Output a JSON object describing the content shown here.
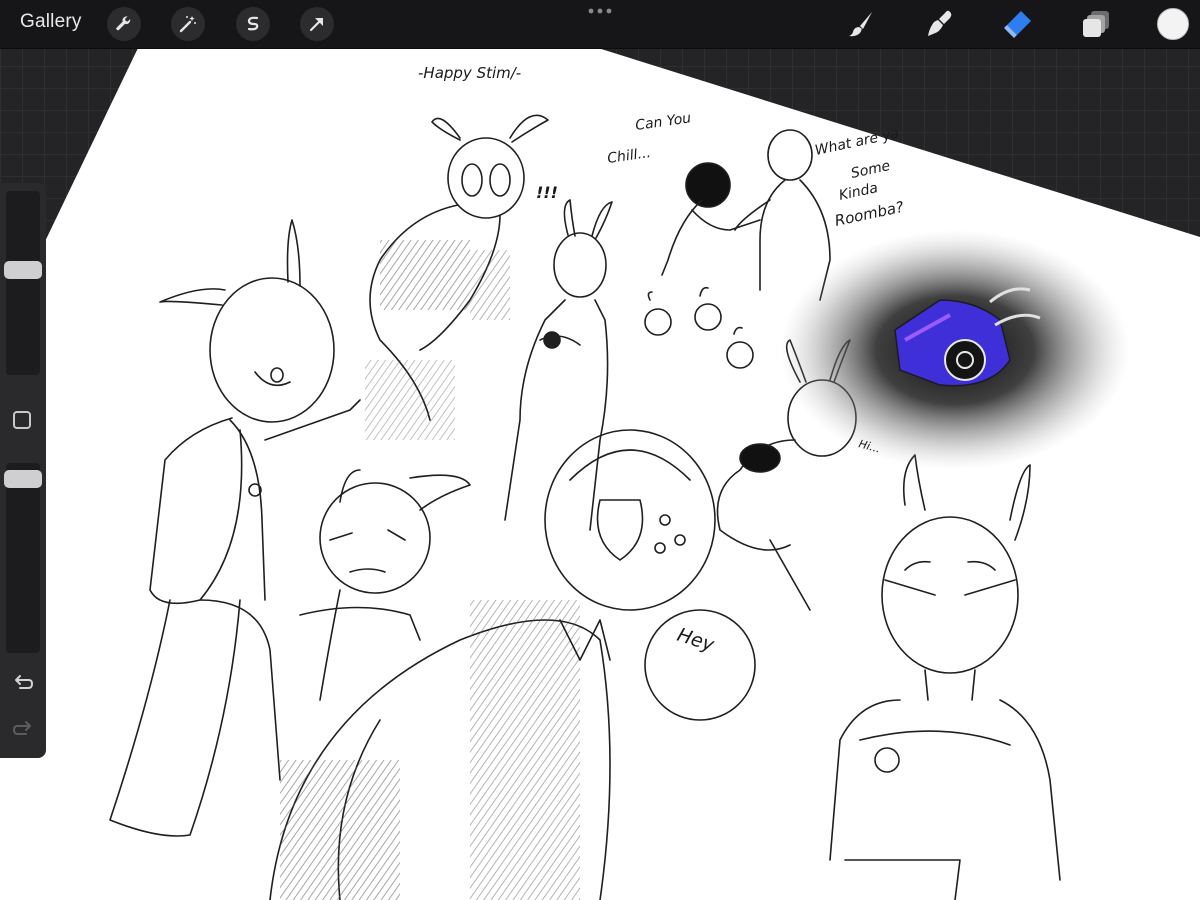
{
  "app": {
    "gallery_label": "Gallery"
  },
  "toolbar": {
    "left_tools": [
      "wrench-icon",
      "magic-wand-icon",
      "selection-icon",
      "transform-arrow-icon"
    ],
    "right_tools": [
      "brush-icon",
      "smudge-icon",
      "eraser-icon",
      "layers-icon"
    ],
    "active_tool": "eraser",
    "active_color": "#f3f3f3",
    "accent_color": "#2f7ef0"
  },
  "sidebar": {
    "brush_size_level": 0.58,
    "opacity_level": 0.96
  },
  "sketch_text": {
    "title": "-Happy Stim/-",
    "can_you_1": "Can You",
    "can_you_2": "Chill...",
    "what_1": "What are ya",
    "what_2": "Some",
    "what_3": "Kinda",
    "what_4": "Roomba?",
    "exclaim": "!!!",
    "hey": "Hey",
    "hi": "Hi..."
  }
}
